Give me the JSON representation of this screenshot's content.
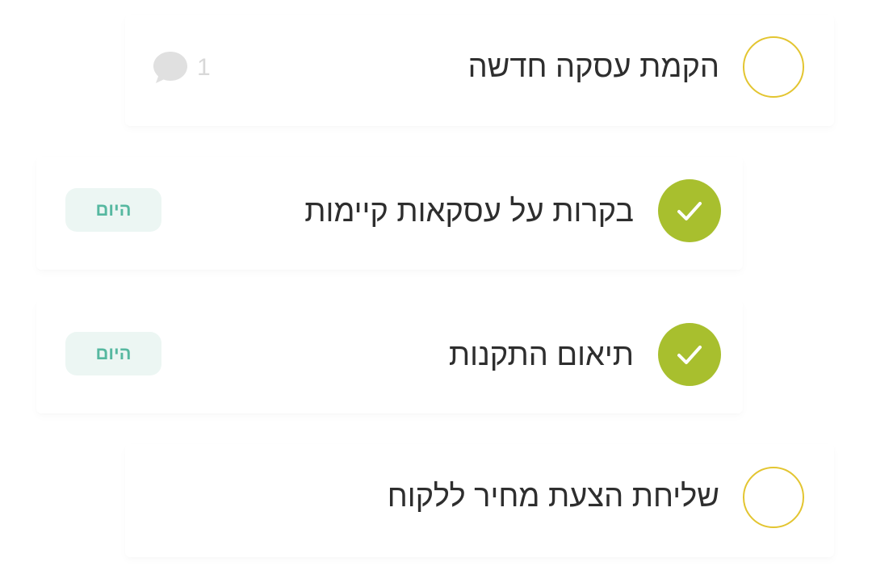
{
  "tasks": [
    {
      "title": "הקמת עסקה חדשה",
      "completed": false,
      "comment_count": "1",
      "comment_icon": "speech-bubble-icon"
    },
    {
      "title": "בקרות על עסקאות קיימות",
      "completed": true,
      "badge": "היום",
      "check_icon": "checkmark-icon"
    },
    {
      "title": "תיאום התקנות",
      "completed": true,
      "badge": "היום",
      "check_icon": "checkmark-icon"
    },
    {
      "title": "שליחת הצעת מחיר ללקוח",
      "completed": false
    }
  ],
  "colors": {
    "pending_ring": "#e3c530",
    "done_fill": "#a8bf2e",
    "badge_bg": "#ecf6f3",
    "badge_text": "#56b8a0",
    "title_text": "#2e2e2e",
    "muted": "#d8d8d8"
  }
}
